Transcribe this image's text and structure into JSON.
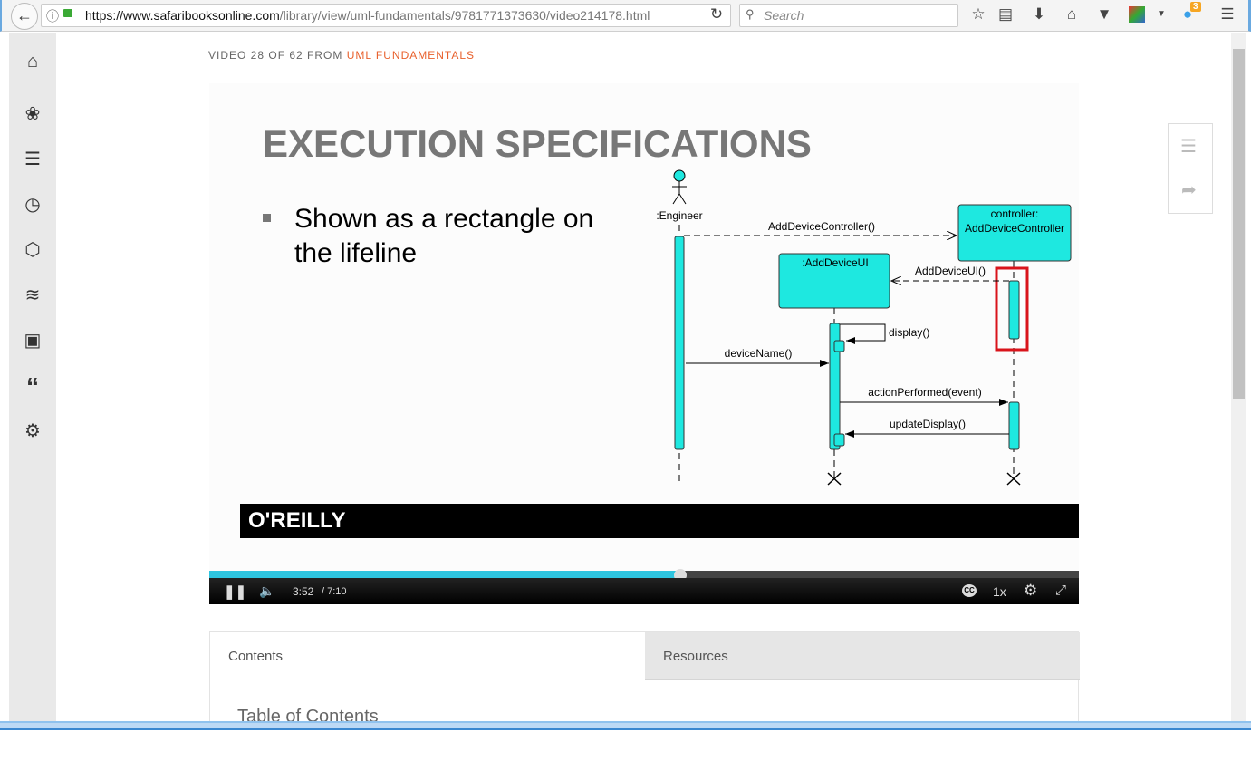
{
  "browser": {
    "url_host": "https://www.safaribooksonline.com",
    "url_path": "/library/view/uml-fundamentals/9781771373630/video214178.html",
    "search_placeholder": "Search",
    "notification_count": "3"
  },
  "breadcrumb": {
    "prefix": "VIDEO 28 OF 62 FROM ",
    "course": "UML FUNDAMENTALS"
  },
  "slide": {
    "title": "EXECUTION SPECIFICATIONS",
    "bullet_line1": "Shown as a rectangle on",
    "bullet_line2": "the lifeline",
    "actor": ":Engineer",
    "controller_line1": "controller:",
    "controller_line2": "AddDeviceController",
    "ui": ":AddDeviceUI",
    "messages": [
      "AddDeviceController()",
      "AddDeviceUI()",
      "display()",
      "deviceName()",
      "actionPerformed(event)",
      "updateDisplay()"
    ],
    "brand": "O'REILLY",
    "highlight_color": "#d9141b",
    "lifeline_color": "#1ee8e0"
  },
  "player": {
    "current_time": "3:52",
    "duration": "/ 7:10",
    "speed": "1x",
    "progress_percent": 54.2,
    "accent": "#2ec5e0"
  },
  "tabs": [
    {
      "label": "Contents"
    },
    {
      "label": "Resources"
    }
  ],
  "contents": {
    "heading": "Table of Contents"
  }
}
